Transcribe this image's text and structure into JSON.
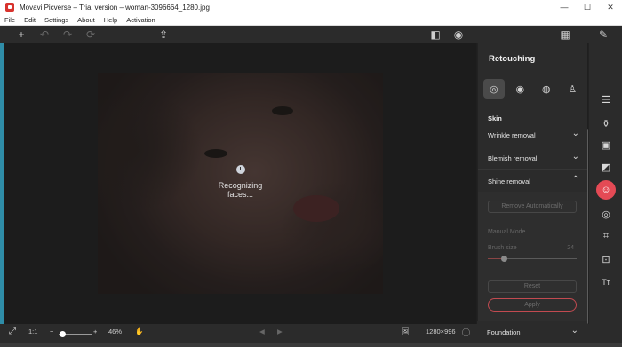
{
  "window": {
    "title": "Movavi Picverse – Trial version – woman-3096664_1280.jpg",
    "minimize": "—",
    "maximize": "☐",
    "close": "✕"
  },
  "menu": [
    "File",
    "Edit",
    "Settings",
    "About",
    "Help",
    "Activation"
  ],
  "toolbar": {
    "add": "+",
    "undo": "↶",
    "redo": "↷",
    "reset": "⟳",
    "export": "⇪",
    "compare": "◧",
    "preview": "◉",
    "grid": "▦",
    "edit": "✎"
  },
  "canvas": {
    "status_text": "Recognizing faces..."
  },
  "bottom": {
    "fit": "⤢",
    "ratio": "1:1",
    "zoom_minus": "−",
    "zoom_plus": "+",
    "zoom_value": "46%",
    "zoom_level_fraction": 0.1,
    "hand": "✋",
    "prev": "◀",
    "next": "▶",
    "image_icon": "🖼",
    "dimensions": "1280×996",
    "info": "ⓘ"
  },
  "panel": {
    "title": "Retouching",
    "tabs": [
      "◎",
      "◉",
      "◍",
      "♙"
    ],
    "section": "Skin",
    "accordions": [
      {
        "label": "Wrinkle removal",
        "chevron": "⌄"
      },
      {
        "label": "Blemish removal",
        "chevron": "⌄"
      },
      {
        "label": "Shine removal",
        "chevron": "⌃"
      }
    ],
    "shine": {
      "auto_button": "Remove Automatically",
      "manual_mode": "Manual Mode",
      "brush_label": "Brush size",
      "brush_value": "24",
      "reset": "Reset",
      "apply": "Apply"
    },
    "foundation": {
      "label": "Foundation",
      "chevron": "⌄"
    }
  },
  "rail": [
    "☰",
    "⚱",
    "▣",
    "◩",
    "☺",
    "◎",
    "⌗",
    "⊡",
    "Tт"
  ],
  "colors": {
    "accent": "#e44a55",
    "panel": "#2b2b2b",
    "canvas": "#1c1c1c"
  }
}
